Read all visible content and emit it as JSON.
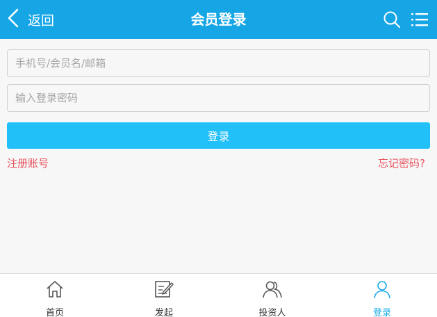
{
  "header": {
    "back_label": "返回",
    "title": "会员登录",
    "background": "#16a6e6",
    "icons": [
      "chevron-left-icon",
      "search-icon",
      "menu-list-icon"
    ]
  },
  "form": {
    "account_placeholder": "手机号/会员名/邮箱",
    "password_placeholder": "输入登录密码",
    "login_label": "登录",
    "login_color": "#22c0f8",
    "register_label": "注册账号",
    "forgot_label": "忘记密码?",
    "link_color": "#e8505b"
  },
  "tabbar": {
    "items": [
      {
        "label": "首页",
        "icon": "home-icon",
        "active": false
      },
      {
        "label": "发起",
        "icon": "edit-icon",
        "active": false
      },
      {
        "label": "投资人",
        "icon": "users-icon",
        "active": false
      },
      {
        "label": "登录",
        "icon": "user-icon",
        "active": true
      }
    ],
    "active_color": "#1aa9e6"
  }
}
